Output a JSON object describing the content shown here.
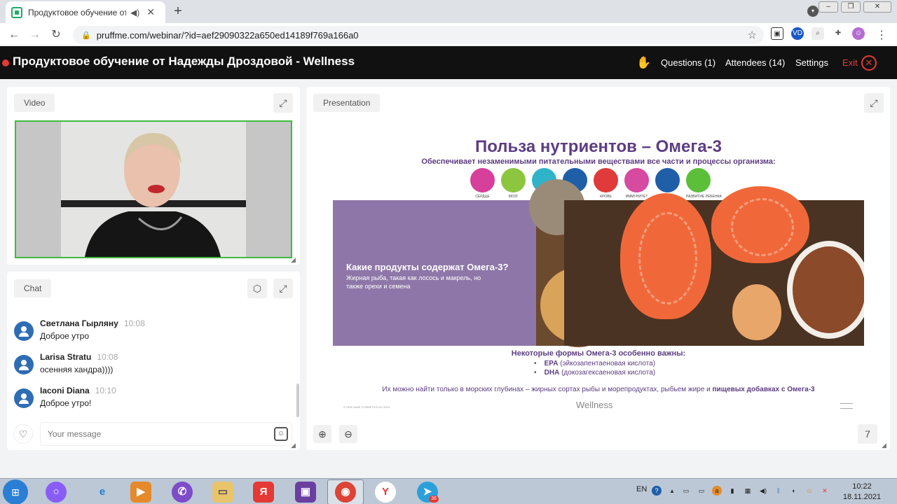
{
  "browser": {
    "tab_title": "Продуктовое обучение от Н",
    "tab_audio_icon": "speaker-icon",
    "url": "pruffme.com/webinar/?id=aef29090322a650ed14189f769a166a0"
  },
  "header": {
    "title": "Продуктовое обучение от Надежды Дроздовой - Wellness",
    "questions": "Questions (1)",
    "attendees": "Attendees (14)",
    "settings": "Settings",
    "exit": "Exit"
  },
  "video": {
    "label": "Video"
  },
  "chat": {
    "label": "Chat",
    "messages": [
      {
        "author": "Светлана Гырляну",
        "time": "10:08",
        "text": "Доброе утро"
      },
      {
        "author": "Larisa Stratu",
        "time": "10:08",
        "text": "осенняя хандра))))"
      },
      {
        "author": "Iaconi Diana",
        "time": "10:10",
        "text": "Доброе утро!"
      }
    ],
    "input_placeholder": "Your message"
  },
  "presentation": {
    "label": "Presentation",
    "page": "7",
    "slide": {
      "title": "Польза нутриентов – Омега-3",
      "subtitle": "Обеспечивает незаменимыми питательными веществами все части и процессы организма:",
      "organs": [
        {
          "label": "СЕРДЦЕ",
          "color": "#d63f9a"
        },
        {
          "label": "МОЗГ",
          "color": "#8cc63f"
        },
        {
          "label": "СУСТАВЫ",
          "color": "#2fb3c9"
        },
        {
          "label": "КОЖА",
          "color": "#1f5fa8"
        },
        {
          "label": "КРОВЬ",
          "color": "#e03a3a"
        },
        {
          "label": "ИММУНИТЕТ",
          "color": "#d64aa0"
        },
        {
          "label": "ЗРЕНИЕ",
          "color": "#1f5fa8"
        },
        {
          "label": "РАЗВИТИЕ РЕБЕНКА",
          "color": "#5bbf3a"
        }
      ],
      "photo_question": "Какие продукты содержат Омега-3?",
      "photo_line1": "Жирная рыба, такая как лосось и макрель, но",
      "photo_line2": "также орехи и семена",
      "forms_title": "Некоторые формы Омега-3 особенно важны:",
      "forms": [
        {
          "name": "EPA",
          "desc": "(эйкозапентаеновая кислота)"
        },
        {
          "name": "DHA",
          "desc": "(докозагексаеновая кислота)"
        }
      ],
      "footer_plain": "Их можно найти только в морских глубинах – жирных сортах рыбы и морепродуктах, рыбьем жире и ",
      "footer_bold": "пищевых добавках с Омега-3",
      "copyright": "© ORIFLAME COSMETICS AG 2019",
      "brand": "Wellness"
    }
  },
  "taskbar": {
    "lang": "EN",
    "time": "10:22",
    "date": "18.11.2021",
    "telegram_badge": "36",
    "yandex_label": "Я"
  }
}
